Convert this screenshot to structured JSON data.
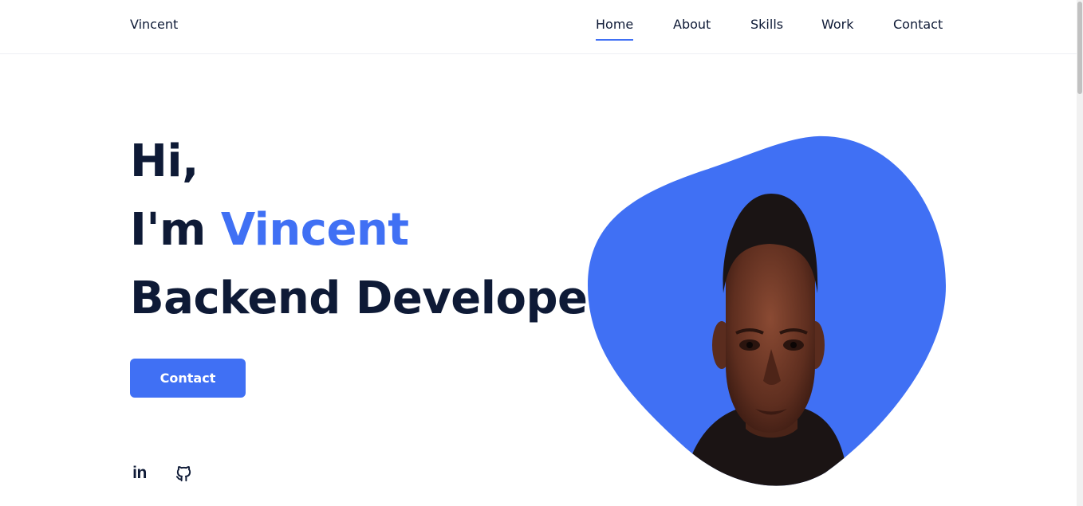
{
  "header": {
    "logo": "Vincent",
    "nav": [
      {
        "label": "Home",
        "active": true
      },
      {
        "label": "About",
        "active": false
      },
      {
        "label": "Skills",
        "active": false
      },
      {
        "label": "Work",
        "active": false
      },
      {
        "label": "Contact",
        "active": false
      }
    ]
  },
  "hero": {
    "greeting": "Hi,",
    "intro_prefix": "I'm ",
    "name": "Vincent",
    "role": "Backend Developer",
    "contact_button": "Contact"
  },
  "social": [
    {
      "name": "linkedin",
      "icon": "linkedin-icon",
      "glyph": "in"
    },
    {
      "name": "github",
      "icon": "github-icon"
    }
  ],
  "colors": {
    "accent": "#4070f4",
    "text": "#0e1a36",
    "background": "#ffffff"
  }
}
